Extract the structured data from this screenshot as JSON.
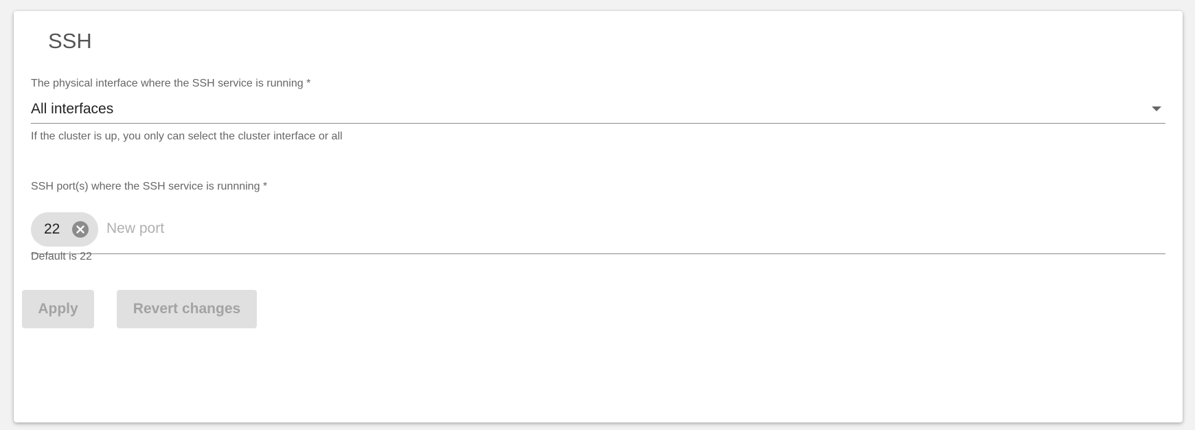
{
  "section": {
    "title": "SSH"
  },
  "interface_field": {
    "label": "The physical interface where the SSH service is running *",
    "value": "All interfaces",
    "hint": "If the cluster is up, you only can select the cluster interface or all"
  },
  "ports_field": {
    "label": "SSH port(s) where the SSH service is runnning *",
    "chips": [
      "22"
    ],
    "placeholder": "New port",
    "hint": "Default is 22"
  },
  "actions": {
    "apply_label": "Apply",
    "revert_label": "Revert changes"
  },
  "icons": {
    "dropdown": "chevron-down-icon",
    "chip_remove": "close-circle-icon"
  },
  "colors": {
    "chip_bg": "#e0e0e0",
    "disabled_button_bg": "#e0e0e0",
    "disabled_button_text": "#a3a3a3"
  }
}
